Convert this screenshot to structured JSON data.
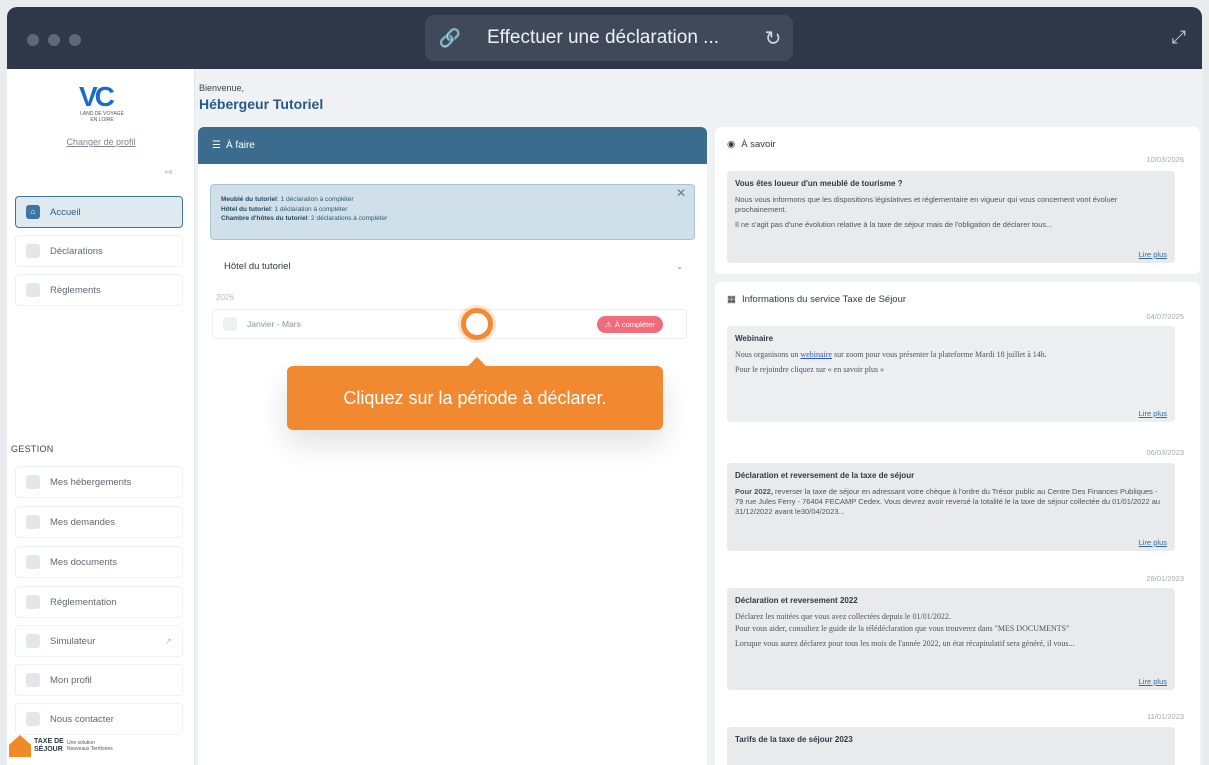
{
  "window": {
    "title": "Effectuer une déclaration ..."
  },
  "sidebar": {
    "logo_text": "VC",
    "logo_sub": "LAND DE VOYAGE EN LOIRE",
    "change_profile": "Changer de profil",
    "items": [
      {
        "label": "Accueil",
        "active": true
      },
      {
        "label": "Déclarations"
      },
      {
        "label": "Règlements"
      }
    ],
    "gestion_label": "GESTION",
    "gestion_items": [
      {
        "label": "Mes hébergements"
      },
      {
        "label": "Mes demandes"
      },
      {
        "label": "Mes documents"
      },
      {
        "label": "Réglementation"
      },
      {
        "label": "Simulateur"
      },
      {
        "label": "Mon profil"
      },
      {
        "label": "Nous contacter"
      }
    ],
    "footer": {
      "brand": "TAXE DE SÉJOUR",
      "tagline": "Une solution Nouveaux Territoires"
    }
  },
  "header": {
    "welcome": "Bienvenue,",
    "name": "Hébergeur Tutoriel"
  },
  "todo": {
    "title": "À faire",
    "summary": [
      {
        "name": "Meublé du tutoriel",
        "text": ": 1 déclaration à compléter"
      },
      {
        "name": "Hôtel du tutoriel",
        "text": ": 1 déclaration à compléter"
      },
      {
        "name": "Chambre d'hôtes du tutoriel",
        "text": ": 2 déclarations à compléter"
      }
    ],
    "section": "Hôtel du tutoriel",
    "year": "2026",
    "period": "Janvier - Mars",
    "status": "À compléter",
    "tooltip": "Cliquez sur la période à déclarer."
  },
  "a_savoir": {
    "title": "À savoir",
    "date": "10/03/2026",
    "heading": "Vous êtes loueur d'un meublé de tourisme ?",
    "p1": "Nous vous informons que les dispositions législatives et réglementaire en vigueur qui vous concernent vont évoluer prochainement.",
    "p2": "Il ne s'agit pas d'une évolution relative à la taxe de séjour mais de l'obligation de déclarer tous...",
    "more": "Lire plus"
  },
  "infos": {
    "title": "Informations du service Taxe de Séjour",
    "items": [
      {
        "date": "04/07/2025",
        "heading": "Webinaire",
        "p1_a": "Nous organisons un ",
        "p1_link": "webinaire",
        "p1_b": " sur zoom pour vous présenter la plateforme Mardi 18 juillet à 14h.",
        "p2": "Pour le rejoindre cliquez sur « en savoir plus »",
        "more": "Lire plus"
      },
      {
        "date": "06/03/2023",
        "heading": "Déclaration et reversement de la taxe de séjour",
        "p1_bold": "Pour 2022,",
        "p1": " reverser la taxe de séjour en adressant votre chèque à l'ordre du Trésor public au Centre Des Finances Publiques - 79 rue Jules Ferry - 76404 FECAMP Cedex. Vous devrez avoir reversé la totalité le la taxe de séjour collectée du 01/01/2022 au 31/12/2022 avant le30/04/2023...",
        "more": "Lire plus"
      },
      {
        "date": "28/01/2023",
        "heading": "Déclaration et reversement 2022",
        "p1": "Déclarez les nuitées que vous avez collectées depuis le 01/01/2022.",
        "p2": "Pour vous aider, consultez le guide de la télédéclaration que vous trouverez dans \"MES DOCUMENTS\"",
        "p3": "Lorsque vous aurez déclarez pour tous les mois de l'année 2022, un état récapitulatif sera généré, il vous...",
        "more": "Lire plus"
      },
      {
        "date": "11/01/2023",
        "heading": "Tarifs de la taxe de séjour 2023"
      }
    ]
  }
}
